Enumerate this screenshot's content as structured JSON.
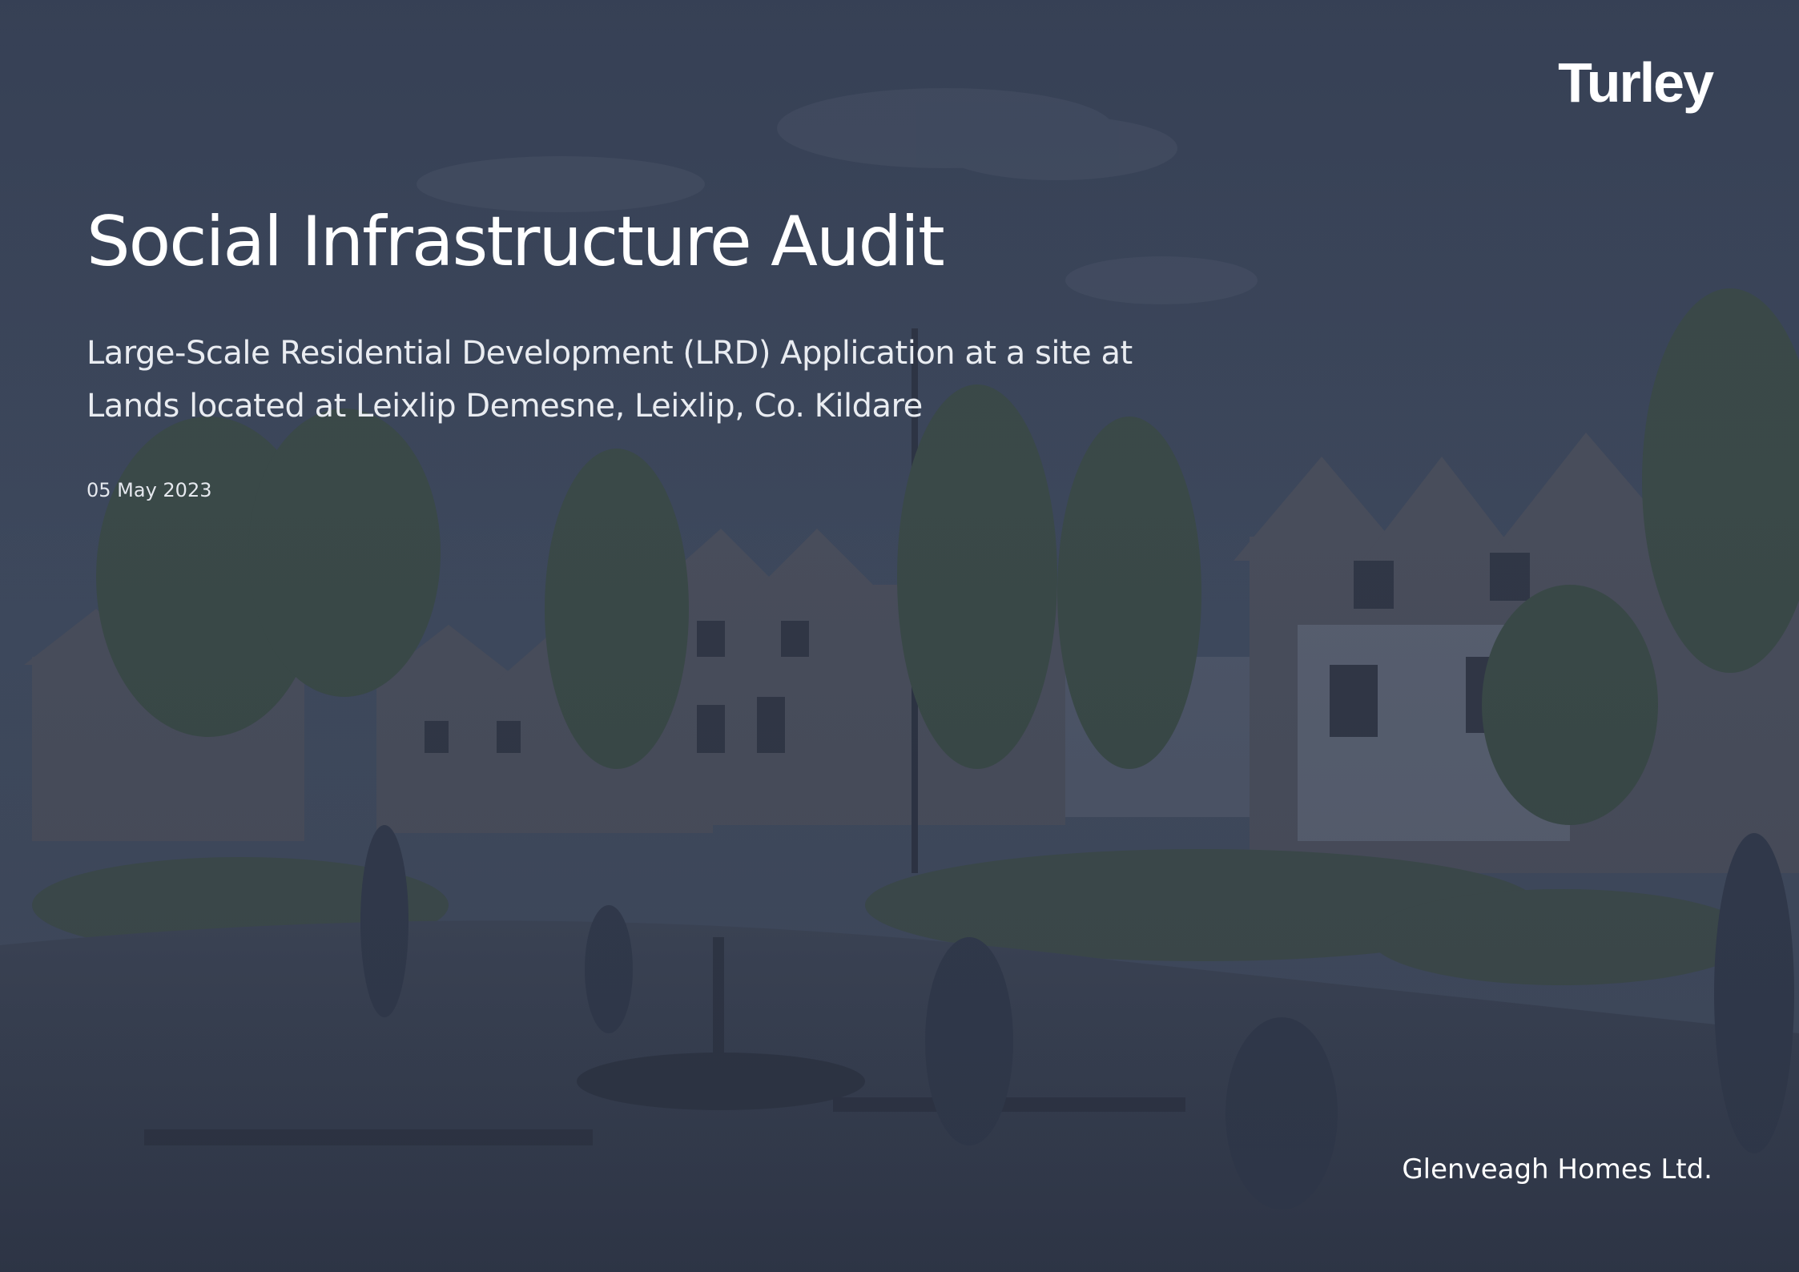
{
  "brand": {
    "logo_text": "Turley",
    "text_color": "#ffffff",
    "overlay_color": "#3c4659"
  },
  "document": {
    "title": "Social Infrastructure Audit",
    "subtitle_lines": [
      "Large-Scale Residential Development (LRD) Application at a site at",
      "Lands located at Leixlip Demesne, Leixlip, Co. Kildare"
    ],
    "date": "05 May 2023",
    "client": "Glenveagh Homes Ltd."
  }
}
